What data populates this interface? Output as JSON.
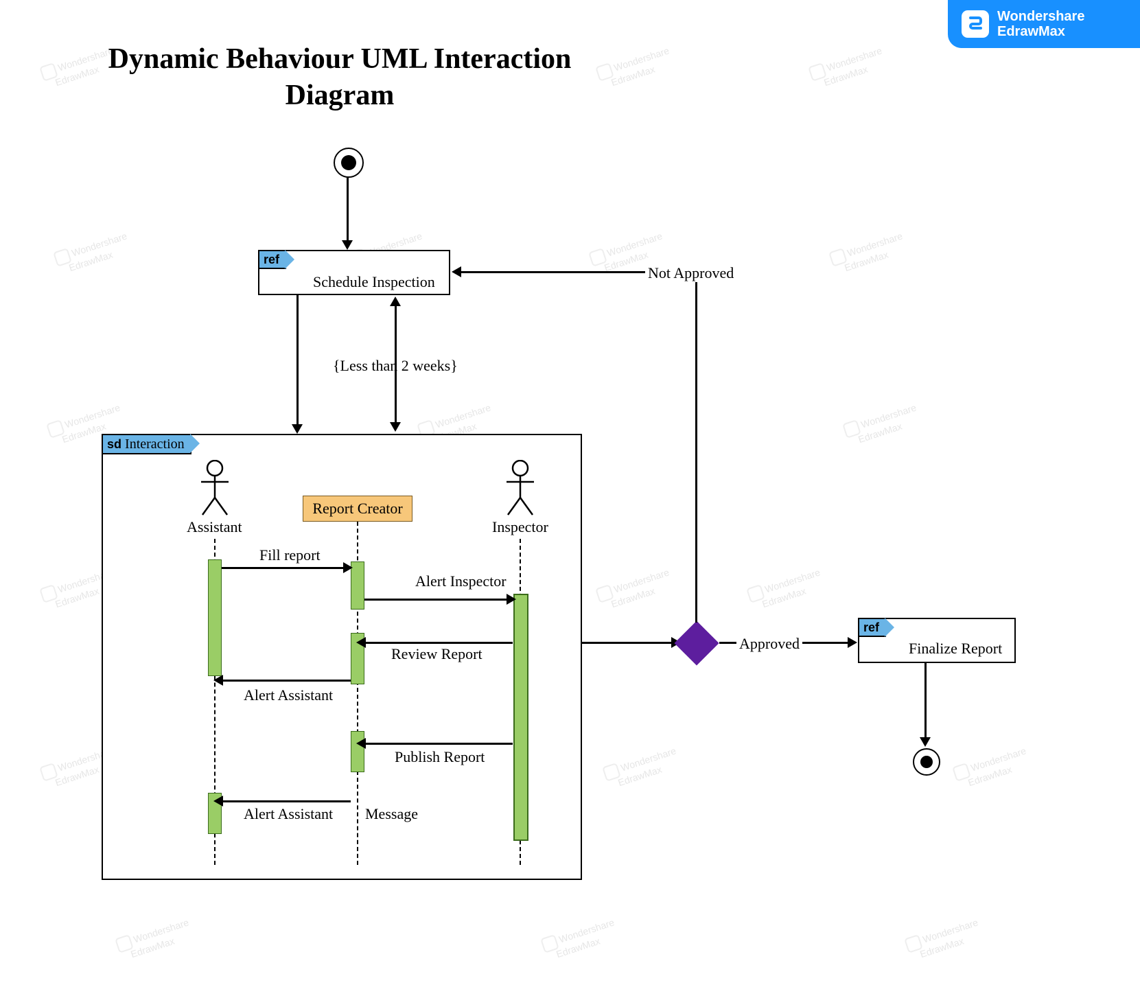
{
  "brand": {
    "line1": "Wondershare",
    "line2": "EdrawMax"
  },
  "title": "Dynamic Behaviour UML Interaction Diagram",
  "schedule": {
    "tab": "ref",
    "label": "Schedule Inspection"
  },
  "guard": "{Less than 2 weeks}",
  "sd": {
    "tab": "sd",
    "title": "Interaction"
  },
  "actors": {
    "assistant": "Assistant",
    "inspector": "Inspector",
    "reportCreator": "Report Creator"
  },
  "messages": {
    "fillReport": "Fill report",
    "alertInspector": "Alert Inspector",
    "reviewReport": "Review Report",
    "alertAssistant1": "Alert Assistant",
    "publishReport": "Publish Report",
    "alertAssistant2": "Alert Assistant",
    "message": "Message"
  },
  "decision": {
    "approved": "Approved",
    "notApproved": "Not Approved"
  },
  "finalize": {
    "tab": "ref",
    "label": "Finalize Report"
  },
  "watermark": {
    "line1": "Wondershare",
    "line2": "EdrawMax"
  }
}
